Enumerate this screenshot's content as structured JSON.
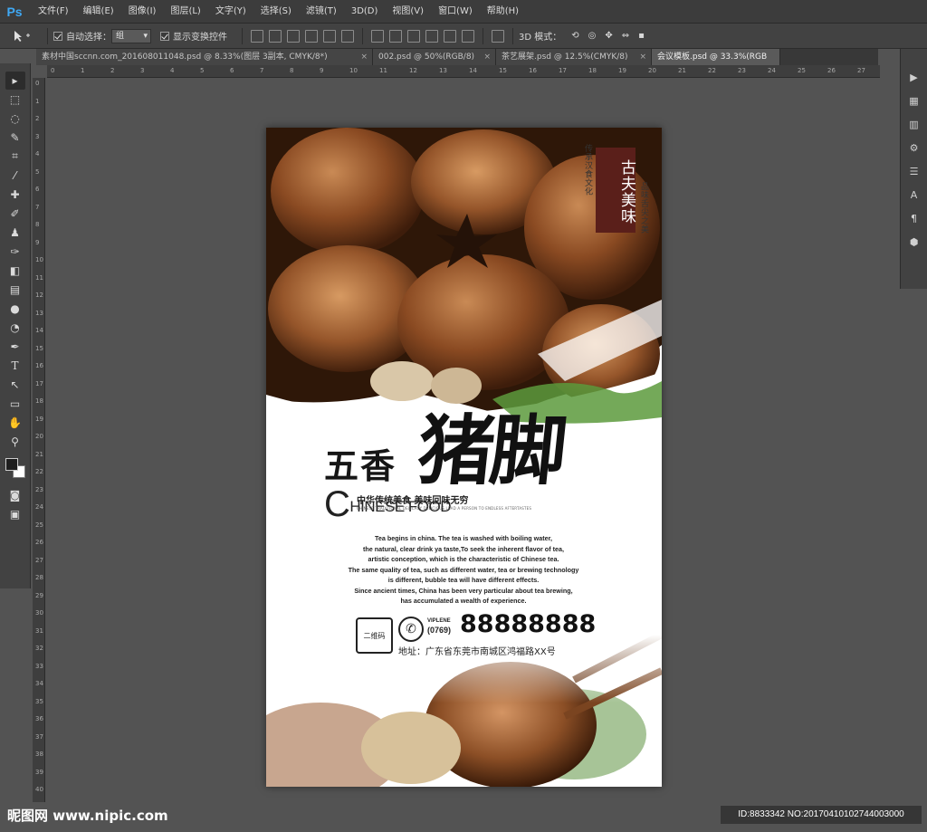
{
  "app": {
    "logo": "Ps"
  },
  "menu": [
    "文件(F)",
    "编辑(E)",
    "图像(I)",
    "图层(L)",
    "文字(Y)",
    "选择(S)",
    "滤镜(T)",
    "3D(D)",
    "视图(V)",
    "窗口(W)",
    "帮助(H)"
  ],
  "options": {
    "move_icon": "move-tool-icon",
    "auto_select_label": "自动选择：",
    "auto_select_value": "组",
    "show_transform_label": "显示变换控件",
    "mode_3d_label": "3D 模式："
  },
  "tabs": [
    {
      "label": "素材中国sccnn.com_20160801104​8.psd @ 8.33%(图层 3副本, CMYK/8*)",
      "active": false
    },
    {
      "label": "002.psd @ 50%(RGB/8)",
      "active": false
    },
    {
      "label": "茶艺展架.psd @ 12.5%(CMYK/8)",
      "active": false
    },
    {
      "label": "会议模板.psd @ 33.3%(RGB",
      "active": true
    }
  ],
  "ruler_top": [
    "0",
    "1",
    "2",
    "3",
    "4",
    "5",
    "6",
    "7",
    "8",
    "9",
    "10",
    "11",
    "12",
    "13",
    "14",
    "15",
    "16",
    "17",
    "18",
    "19",
    "20",
    "21",
    "22",
    "23",
    "24",
    "25",
    "26",
    "27"
  ],
  "ruler_left": [
    "0",
    "1",
    "2",
    "3",
    "4",
    "5",
    "6",
    "7",
    "8",
    "9",
    "10",
    "11",
    "12",
    "13",
    "14",
    "15",
    "16",
    "17",
    "18",
    "19",
    "20",
    "21",
    "22",
    "23",
    "24",
    "25",
    "26",
    "27",
    "28",
    "29",
    "30",
    "31",
    "32",
    "33",
    "34",
    "35",
    "36",
    "37",
    "38",
    "39",
    "40"
  ],
  "tools": [
    "move-icon",
    "marquee-icon",
    "lasso-icon",
    "quick-select-icon",
    "crop-icon",
    "eyedropper-icon",
    "healing-icon",
    "brush-icon",
    "stamp-icon",
    "history-brush-icon",
    "eraser-icon",
    "gradient-icon",
    "blur-icon",
    "dodge-icon",
    "pen-icon",
    "type-icon",
    "path-select-icon",
    "shape-icon",
    "hand-icon",
    "zoom-icon"
  ],
  "poster": {
    "tag": "古夫美味",
    "vert_left": "传承汉食文化",
    "vert_right": "品味舌尖之美",
    "title_small": "五香",
    "title_brush": "猪脚",
    "subline": "中华传统美食  美味回味无穷",
    "microline": "CHINESE TRADITIONAL DELICACY DELICIOUS LEAD A PERSON TO ENDLESS AFTERTASTES",
    "chinese_food_c": "C",
    "chinese_food_rest": "HINESE FOOD",
    "body": [
      "Tea begins in china. The tea is washed with boiling water,",
      "the natural, clear drink ya taste,To seek the inherent flavor of tea,",
      "artistic conception, which is the characteristic of Chinese tea.",
      "The same quality of tea, such as different water, tea or brewing technology",
      "is different, bubble tea will have different effects.",
      "Since ancient times, China has been very particular about tea brewing,",
      "has accumulated a wealth of experience."
    ],
    "qr_label": "二维码",
    "phone_icon": "phone-icon",
    "viplene": "VIPLENE",
    "areacode": "(0769)",
    "phone": "88888888",
    "address": "地址：广东省东莞市南城区鸿福路XX号"
  },
  "watermark": {
    "left": "昵图网 www.nipic.com",
    "right": "ID:8833342 NO:20170410102744003000"
  }
}
